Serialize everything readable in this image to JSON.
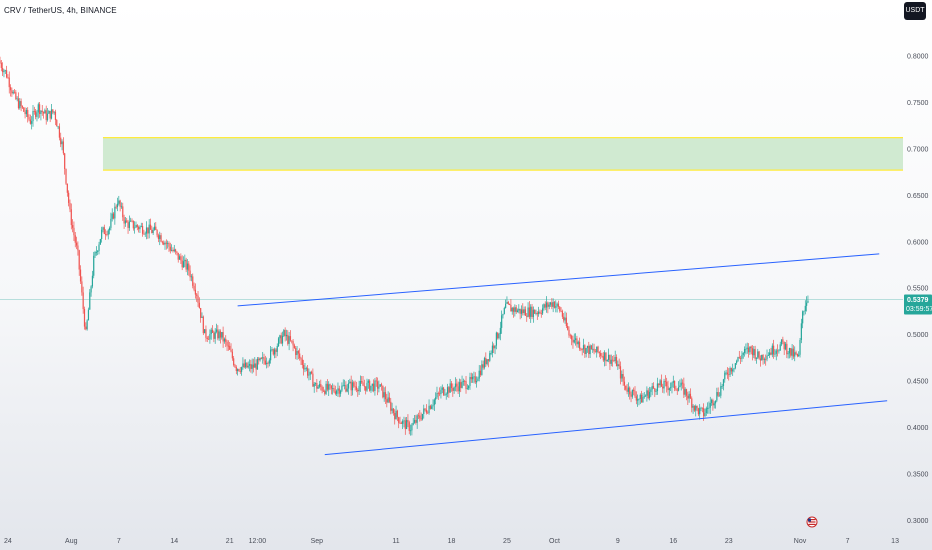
{
  "header": {
    "title": "CRV / TetherUS, 4h, BINANCE",
    "currency_label": "USDT"
  },
  "price_badge": {
    "price": "0.5379",
    "countdown": "03:59:57"
  },
  "colors": {
    "up": "#26a69a",
    "down": "#ef5350",
    "channel": "#2962ff",
    "zone_fill": "#c8e6c9",
    "zone_border": "#ffeb3b",
    "price_line": "#26a69a"
  },
  "chart_data": {
    "type": "candlestick",
    "ylim": [
      0.29,
      0.86
    ],
    "y_ticks": [
      {
        "value": 0.8,
        "label": "0.8000"
      },
      {
        "value": 0.75,
        "label": "0.7500"
      },
      {
        "value": 0.7,
        "label": "0.7000"
      },
      {
        "value": 0.65,
        "label": "0.6500"
      },
      {
        "value": 0.6,
        "label": "0.6000"
      },
      {
        "value": 0.55,
        "label": "0.5500"
      },
      {
        "value": 0.5,
        "label": "0.5000"
      },
      {
        "value": 0.45,
        "label": "0.4500"
      },
      {
        "value": 0.4,
        "label": "0.4000"
      },
      {
        "value": 0.35,
        "label": "0.3500"
      },
      {
        "value": 0.3,
        "label": "0.3000"
      }
    ],
    "x_range": [
      "2023-07-23",
      "2023-11-14"
    ],
    "x_ticks": [
      {
        "date": "2023-07-24",
        "label": "24"
      },
      {
        "date": "2023-08-01",
        "label": "Aug"
      },
      {
        "date": "2023-08-07",
        "label": "7"
      },
      {
        "date": "2023-08-14",
        "label": "14"
      },
      {
        "date": "2023-08-21",
        "label": "21"
      },
      {
        "date": "2023-08-24 12:00",
        "label": "12:00"
      },
      {
        "date": "2023-09-01",
        "label": "Sep"
      },
      {
        "date": "2023-09-11",
        "label": "11"
      },
      {
        "date": "2023-09-18",
        "label": "18"
      },
      {
        "date": "2023-09-25",
        "label": "25"
      },
      {
        "date": "2023-10-01",
        "label": "Oct"
      },
      {
        "date": "2023-10-09",
        "label": "9"
      },
      {
        "date": "2023-10-16",
        "label": "16"
      },
      {
        "date": "2023-10-23",
        "label": "23"
      },
      {
        "date": "2023-11-01",
        "label": "Nov"
      },
      {
        "date": "2023-11-07",
        "label": "7"
      },
      {
        "date": "2023-11-13",
        "label": "13"
      }
    ],
    "interval": "4h",
    "last_price": 0.5379,
    "price_path": [
      [
        "2023-07-23",
        0.795
      ],
      [
        "2023-07-24",
        0.78
      ],
      [
        "2023-07-25",
        0.755
      ],
      [
        "2023-07-27",
        0.73
      ],
      [
        "2023-07-28",
        0.745
      ],
      [
        "2023-07-29",
        0.735
      ],
      [
        "2023-07-30",
        0.74
      ],
      [
        "2023-07-31",
        0.705
      ],
      [
        "2023-08-01",
        0.63
      ],
      [
        "2023-08-02",
        0.585
      ],
      [
        "2023-08-03",
        0.5
      ],
      [
        "2023-08-04",
        0.58
      ],
      [
        "2023-08-05",
        0.61
      ],
      [
        "2023-08-06",
        0.615
      ],
      [
        "2023-08-07",
        0.645
      ],
      [
        "2023-08-08",
        0.62
      ],
      [
        "2023-08-10",
        0.615
      ],
      [
        "2023-08-12",
        0.61
      ],
      [
        "2023-08-14",
        0.59
      ],
      [
        "2023-08-16",
        0.57
      ],
      [
        "2023-08-17",
        0.545
      ],
      [
        "2023-08-18",
        0.5
      ],
      [
        "2023-08-20",
        0.5
      ],
      [
        "2023-08-21",
        0.485
      ],
      [
        "2023-08-22",
        0.465
      ],
      [
        "2023-08-24",
        0.465
      ],
      [
        "2023-08-26",
        0.475
      ],
      [
        "2023-08-28",
        0.5
      ],
      [
        "2023-08-29",
        0.49
      ],
      [
        "2023-08-31",
        0.46
      ],
      [
        "2023-09-01",
        0.445
      ],
      [
        "2023-09-03",
        0.44
      ],
      [
        "2023-09-05",
        0.445
      ],
      [
        "2023-09-07",
        0.445
      ],
      [
        "2023-09-09",
        0.445
      ],
      [
        "2023-09-11",
        0.415
      ],
      [
        "2023-09-12",
        0.405
      ],
      [
        "2023-09-13",
        0.4
      ],
      [
        "2023-09-15",
        0.42
      ],
      [
        "2023-09-17",
        0.44
      ],
      [
        "2023-09-19",
        0.445
      ],
      [
        "2023-09-21",
        0.45
      ],
      [
        "2023-09-23",
        0.48
      ],
      [
        "2023-09-24",
        0.5
      ],
      [
        "2023-09-25",
        0.53
      ],
      [
        "2023-09-27",
        0.525
      ],
      [
        "2023-09-29",
        0.525
      ],
      [
        "2023-10-01",
        0.535
      ],
      [
        "2023-10-02",
        0.525
      ],
      [
        "2023-10-03",
        0.5
      ],
      [
        "2023-10-05",
        0.485
      ],
      [
        "2023-10-07",
        0.48
      ],
      [
        "2023-10-09",
        0.47
      ],
      [
        "2023-10-10",
        0.445
      ],
      [
        "2023-10-12",
        0.43
      ],
      [
        "2023-10-14",
        0.445
      ],
      [
        "2023-10-16",
        0.445
      ],
      [
        "2023-10-17",
        0.445
      ],
      [
        "2023-10-18",
        0.435
      ],
      [
        "2023-10-19",
        0.42
      ],
      [
        "2023-10-20",
        0.415
      ],
      [
        "2023-10-22",
        0.44
      ],
      [
        "2023-10-23",
        0.46
      ],
      [
        "2023-10-25",
        0.48
      ],
      [
        "2023-10-26",
        0.485
      ],
      [
        "2023-10-27",
        0.475
      ],
      [
        "2023-10-28",
        0.48
      ],
      [
        "2023-10-30",
        0.49
      ],
      [
        "2023-10-31",
        0.48
      ],
      [
        "2023-11-01",
        0.475
      ],
      [
        "2023-11-01 12:00",
        0.525
      ],
      [
        "2023-11-02",
        0.538
      ]
    ],
    "annotations": {
      "resistance_zone": {
        "y_top": 0.712,
        "y_bottom": 0.677,
        "x_start": "2023-08-05",
        "x_end": "2023-11-14"
      },
      "upper_channel_line": {
        "start": [
          "2023-08-22",
          0.531
        ],
        "end": [
          "2023-11-11",
          0.587
        ]
      },
      "lower_channel_line": {
        "start": [
          "2023-09-02",
          0.371
        ],
        "end": [
          "2023-11-12",
          0.429
        ]
      },
      "current_price_line": 0.5379
    }
  }
}
